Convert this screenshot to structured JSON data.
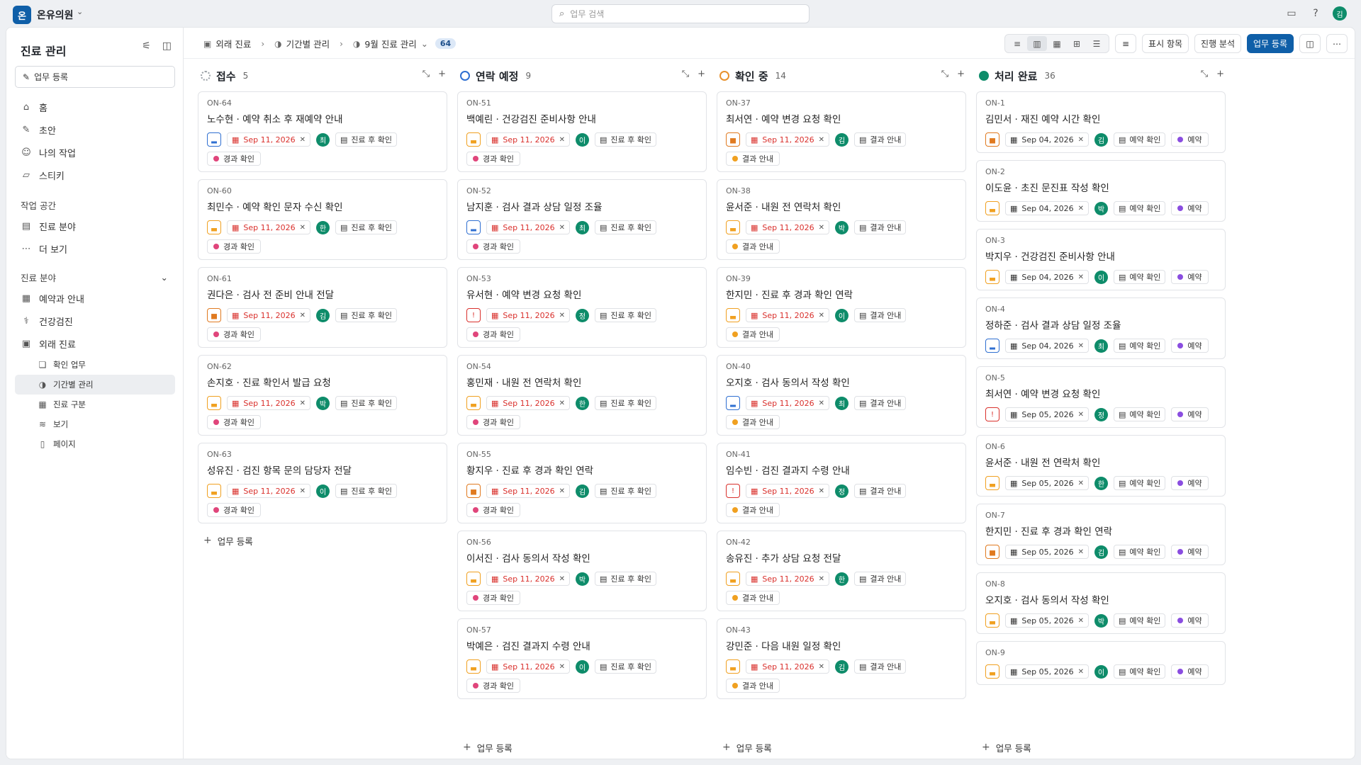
{
  "workspace": {
    "logo": "온",
    "name": "온유의원"
  },
  "search": {
    "placeholder": "업무 검색"
  },
  "user": {
    "avatar": "김"
  },
  "sidebar": {
    "title": "진료 관리",
    "new_task": "업무 등록",
    "items": [
      {
        "label": "홈",
        "icon": "home-icon"
      },
      {
        "label": "초안",
        "icon": "pen-icon"
      },
      {
        "label": "나의 작업",
        "icon": "user-icon"
      },
      {
        "label": "스티키",
        "icon": "sticky-icon"
      }
    ],
    "workspace_label": "작업 공간",
    "workspace_items": [
      {
        "label": "진료 분야",
        "icon": "briefcase-icon"
      },
      {
        "label": "더 보기",
        "icon": "more-icon"
      }
    ],
    "area_label": "진료 분야",
    "areas": [
      {
        "label": "예약과 안내",
        "icon": "calendar-icon"
      },
      {
        "label": "건강검진",
        "icon": "stethoscope-icon"
      },
      {
        "label": "외래 진료",
        "icon": "hospital-icon"
      }
    ],
    "sub_items": [
      {
        "label": "확인 업무",
        "icon": "layers-icon"
      },
      {
        "label": "기간별 관리",
        "icon": "half-circle-icon"
      },
      {
        "label": "진료 구분",
        "icon": "grid-icon"
      },
      {
        "label": "보기",
        "icon": "stack-icon"
      },
      {
        "label": "페이지",
        "icon": "page-icon"
      }
    ]
  },
  "breadcrumb": {
    "area": "외래 진료",
    "section": "기간별 관리",
    "cycle": "9월 진료 관리",
    "count": "64"
  },
  "toolbar": {
    "display": "표시 항목",
    "analysis": "진행 분석",
    "register": "업무 등록"
  },
  "add_label": "업무 등록",
  "columns": [
    {
      "title": "접수",
      "count": "5",
      "status_color": "#9aa0a6",
      "cards": [
        {
          "id": "ON-64",
          "title": "노수현 · 예약 취소 후 재예약 안내",
          "prio": "low",
          "date": "Sep 11, 2026",
          "assignee": "최",
          "project": "진료 후 확인",
          "label": "경과 확인",
          "label_color": "#e0457b"
        },
        {
          "id": "ON-60",
          "title": "최민수 · 예약 확인 문자 수신 확인",
          "prio": "mid",
          "date": "Sep 11, 2026",
          "assignee": "한",
          "project": "진료 후 확인",
          "label": "경과 확인",
          "label_color": "#e0457b"
        },
        {
          "id": "ON-61",
          "title": "권다은 · 검사 전 준비 안내 전달",
          "prio": "high",
          "date": "Sep 11, 2026",
          "assignee": "김",
          "project": "진료 후 확인",
          "label": "경과 확인",
          "label_color": "#e0457b"
        },
        {
          "id": "ON-62",
          "title": "손지호 · 진료 확인서 발급 요청",
          "prio": "mid",
          "date": "Sep 11, 2026",
          "assignee": "박",
          "project": "진료 후 확인",
          "label": "경과 확인",
          "label_color": "#e0457b"
        },
        {
          "id": "ON-63",
          "title": "성유진 · 검진 항목 문의 담당자 전달",
          "prio": "mid",
          "date": "Sep 11, 2026",
          "assignee": "이",
          "project": "진료 후 확인",
          "label": "경과 확인",
          "label_color": "#e0457b"
        }
      ]
    },
    {
      "title": "연락 예정",
      "count": "9",
      "status_color": "#2f6fd1",
      "cards": [
        {
          "id": "ON-51",
          "title": "백예린 · 건강검진 준비사항 안내",
          "prio": "mid",
          "date": "Sep 11, 2026",
          "assignee": "이",
          "project": "진료 후 확인",
          "label": "경과 확인",
          "label_color": "#e0457b"
        },
        {
          "id": "ON-52",
          "title": "남지훈 · 검사 결과 상담 일정 조율",
          "prio": "low",
          "date": "Sep 11, 2026",
          "assignee": "최",
          "project": "진료 후 확인",
          "label": "경과 확인",
          "label_color": "#e0457b"
        },
        {
          "id": "ON-53",
          "title": "유서현 · 예약 변경 요청 확인",
          "prio": "urgent",
          "date": "Sep 11, 2026",
          "assignee": "정",
          "project": "진료 후 확인",
          "label": "경과 확인",
          "label_color": "#e0457b"
        },
        {
          "id": "ON-54",
          "title": "홍민재 · 내원 전 연락처 확인",
          "prio": "mid",
          "date": "Sep 11, 2026",
          "assignee": "한",
          "project": "진료 후 확인",
          "label": "경과 확인",
          "label_color": "#e0457b"
        },
        {
          "id": "ON-55",
          "title": "황지우 · 진료 후 경과 확인 연락",
          "prio": "high",
          "date": "Sep 11, 2026",
          "assignee": "김",
          "project": "진료 후 확인",
          "label": "경과 확인",
          "label_color": "#e0457b"
        },
        {
          "id": "ON-56",
          "title": "이서진 · 검사 동의서 작성 확인",
          "prio": "mid",
          "date": "Sep 11, 2026",
          "assignee": "박",
          "project": "진료 후 확인",
          "label": "경과 확인",
          "label_color": "#e0457b"
        },
        {
          "id": "ON-57",
          "title": "박예은 · 검진 결과지 수령 안내",
          "prio": "mid",
          "date": "Sep 11, 2026",
          "assignee": "이",
          "project": "진료 후 확인",
          "label": "경과 확인",
          "label_color": "#e0457b"
        }
      ]
    },
    {
      "title": "확인 중",
      "count": "14",
      "status_color": "#e8912d",
      "cards": [
        {
          "id": "ON-37",
          "title": "최서연 · 예약 변경 요청 확인",
          "prio": "high",
          "date": "Sep 11, 2026",
          "assignee": "김",
          "project": "결과 안내",
          "label": "결과 안내",
          "label_color": "#f0a020"
        },
        {
          "id": "ON-38",
          "title": "윤서준 · 내원 전 연락처 확인",
          "prio": "mid",
          "date": "Sep 11, 2026",
          "assignee": "박",
          "project": "결과 안내",
          "label": "결과 안내",
          "label_color": "#f0a020"
        },
        {
          "id": "ON-39",
          "title": "한지민 · 진료 후 경과 확인 연락",
          "prio": "mid",
          "date": "Sep 11, 2026",
          "assignee": "이",
          "project": "결과 안내",
          "label": "결과 안내",
          "label_color": "#f0a020"
        },
        {
          "id": "ON-40",
          "title": "오지호 · 검사 동의서 작성 확인",
          "prio": "low",
          "date": "Sep 11, 2026",
          "assignee": "최",
          "project": "결과 안내",
          "label": "결과 안내",
          "label_color": "#f0a020"
        },
        {
          "id": "ON-41",
          "title": "임수빈 · 검진 결과지 수령 안내",
          "prio": "urgent",
          "date": "Sep 11, 2026",
          "assignee": "정",
          "project": "결과 안내",
          "label": "결과 안내",
          "label_color": "#f0a020"
        },
        {
          "id": "ON-42",
          "title": "송유진 · 추가 상담 요청 전달",
          "prio": "mid",
          "date": "Sep 11, 2026",
          "assignee": "한",
          "project": "결과 안내",
          "label": "결과 안내",
          "label_color": "#f0a020"
        },
        {
          "id": "ON-43",
          "title": "강민준 · 다음 내원 일정 확인",
          "prio": "mid",
          "date": "Sep 11, 2026",
          "assignee": "김",
          "project": "결과 안내",
          "label": "결과 안내",
          "label_color": "#f0a020"
        }
      ]
    },
    {
      "title": "처리 완료",
      "count": "36",
      "status_color": "#0e8c6a",
      "cards": [
        {
          "id": "ON-1",
          "title": "김민서 · 재진 예약 시간 확인",
          "prio": "high",
          "date": "Sep 04, 2026",
          "assignee": "김",
          "project": "예약 확인",
          "label": "예약",
          "label_color": "#8a4de0"
        },
        {
          "id": "ON-2",
          "title": "이도윤 · 초진 문진표 작성 확인",
          "prio": "mid",
          "date": "Sep 04, 2026",
          "assignee": "박",
          "project": "예약 확인",
          "label": "예약",
          "label_color": "#8a4de0"
        },
        {
          "id": "ON-3",
          "title": "박지우 · 건강검진 준비사항 안내",
          "prio": "mid",
          "date": "Sep 04, 2026",
          "assignee": "이",
          "project": "예약 확인",
          "label": "예약",
          "label_color": "#8a4de0"
        },
        {
          "id": "ON-4",
          "title": "정하준 · 검사 결과 상담 일정 조율",
          "prio": "low",
          "date": "Sep 04, 2026",
          "assignee": "최",
          "project": "예약 확인",
          "label": "예약",
          "label_color": "#8a4de0"
        },
        {
          "id": "ON-5",
          "title": "최서연 · 예약 변경 요청 확인",
          "prio": "urgent",
          "date": "Sep 05, 2026",
          "assignee": "정",
          "project": "예약 확인",
          "label": "예약",
          "label_color": "#8a4de0"
        },
        {
          "id": "ON-6",
          "title": "윤서준 · 내원 전 연락처 확인",
          "prio": "mid",
          "date": "Sep 05, 2026",
          "assignee": "한",
          "project": "예약 확인",
          "label": "예약",
          "label_color": "#8a4de0"
        },
        {
          "id": "ON-7",
          "title": "한지민 · 진료 후 경과 확인 연락",
          "prio": "high",
          "date": "Sep 05, 2026",
          "assignee": "김",
          "project": "예약 확인",
          "label": "예약",
          "label_color": "#8a4de0"
        },
        {
          "id": "ON-8",
          "title": "오지호 · 검사 동의서 작성 확인",
          "prio": "mid",
          "date": "Sep 05, 2026",
          "assignee": "박",
          "project": "예약 확인",
          "label": "예약",
          "label_color": "#8a4de0"
        },
        {
          "id": "ON-9",
          "title": "",
          "prio": "mid",
          "date": "Sep 05, 2026",
          "assignee": "이",
          "project": "예약 확인",
          "label": "예약",
          "label_color": "#8a4de0"
        }
      ]
    }
  ],
  "colors": {
    "accent": "#0f5fa8",
    "overdue": "#d9302c",
    "avatar": "#0e8c6a",
    "prio_low": "#2f6fd1",
    "prio_mid": "#f0a020",
    "prio_high": "#e07a20",
    "prio_urgent": "#d9302c"
  }
}
